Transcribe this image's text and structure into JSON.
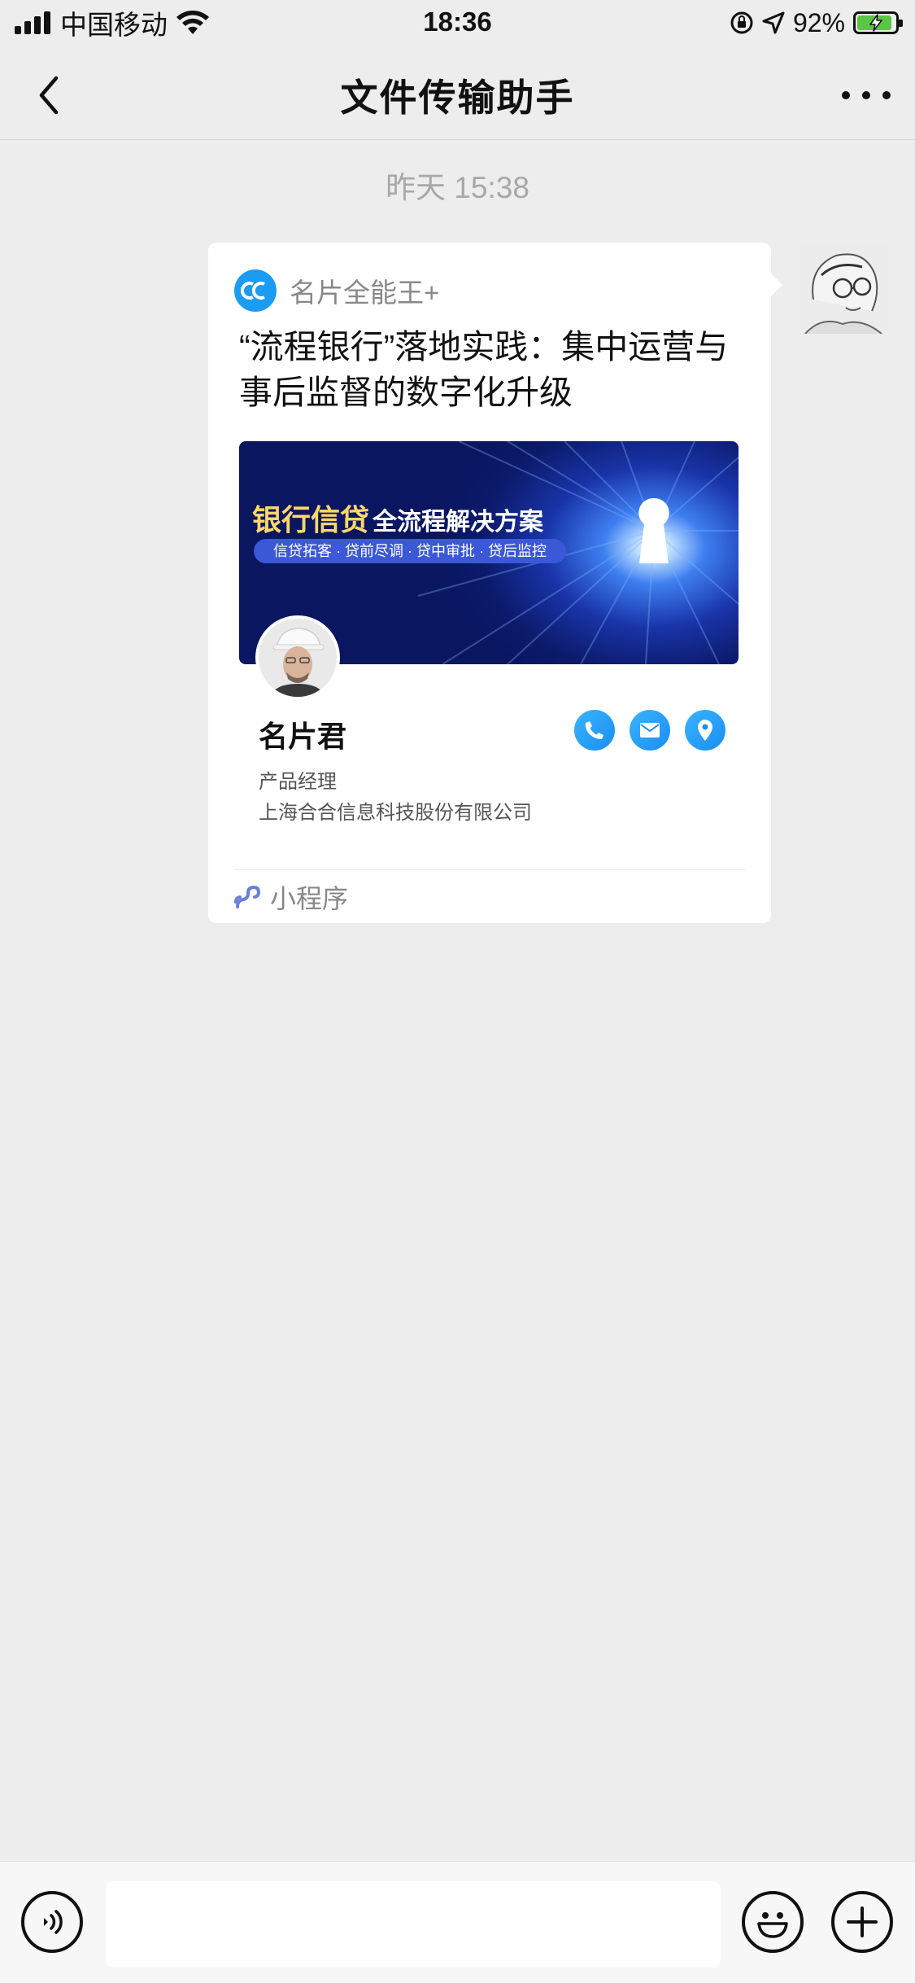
{
  "status_bar": {
    "carrier": "中国移动",
    "time": "18:36",
    "battery_percent": "92%",
    "battery_level": 0.92,
    "icons": [
      "signal-icon",
      "wifi-icon",
      "rotation-lock-icon",
      "location-arrow-icon",
      "battery-charging-icon"
    ]
  },
  "nav": {
    "title": "文件传输助手",
    "back_icon": "chevron-left-icon",
    "more_icon": "more-dots-icon"
  },
  "chat": {
    "timestamp": "昨天 15:38",
    "message": {
      "app_name": "名片全能王+",
      "title": "“流程银行”落地实践：集中运营与事后监督的数字化升级",
      "banner": {
        "title_highlight": "银行信贷",
        "title_rest": "全流程解决方案",
        "tags": "信贷拓客 · 贷前尽调 · 贷中审批 · 贷后监控"
      },
      "person": {
        "name": "名片君",
        "role": "产品经理",
        "company": "上海合合信息科技股份有限公司"
      },
      "contact_icons": [
        "phone-icon",
        "mail-icon",
        "location-icon"
      ],
      "footer_label": "小程序"
    }
  },
  "input_bar": {
    "text_value": "",
    "icons": [
      "voice-icon",
      "emoji-icon",
      "plus-icon"
    ]
  },
  "colors": {
    "background": "#ededed",
    "accent_blue": "#1b9cf2",
    "battery_green": "#5ac645"
  }
}
